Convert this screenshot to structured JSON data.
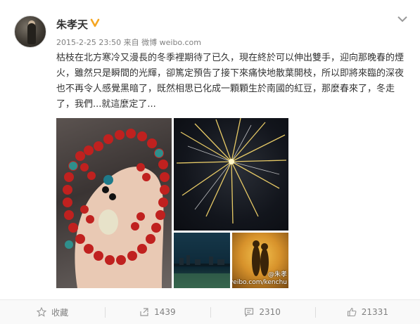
{
  "post": {
    "author": "朱孝天",
    "verified": true,
    "timestamp": "2015-2-25 23:50",
    "source_prefix": "来自",
    "source": "微博 weibo.com",
    "content": "枯枝在北方寒冷又漫長的冬季裡期待了已久，現在終於可以伸出雙手，迎向那晚春的煙火，雖然只是瞬間的光輝，卻篤定預告了接下來痛快地散葉開枝，所以即將來臨的深夜也不再令人感覺黑暗了，既然相思已化成一顆顆生於南國的紅豆，那麼春來了，冬走了，我們...就這麼定了...",
    "images": [
      {
        "name": "beads-photo"
      },
      {
        "name": "fireworks-photo"
      },
      {
        "name": "city-night-photo"
      },
      {
        "name": "sunset-couple-photo"
      }
    ],
    "watermark": {
      "line1": "@朱孝",
      "line2": "weibo.com/kenchu"
    }
  },
  "actions": {
    "favorite": {
      "label": "收藏",
      "icon": "star-icon"
    },
    "repost": {
      "count": "1439",
      "icon": "repost-icon"
    },
    "comment": {
      "count": "2310",
      "icon": "comment-icon"
    },
    "like": {
      "count": "21331",
      "icon": "thumbs-up-icon"
    }
  },
  "colors": {
    "verified_badge": "#f5a623",
    "meta_text": "#808080",
    "body_text": "#333333",
    "action_bar_bg": "#f9f9f9"
  }
}
